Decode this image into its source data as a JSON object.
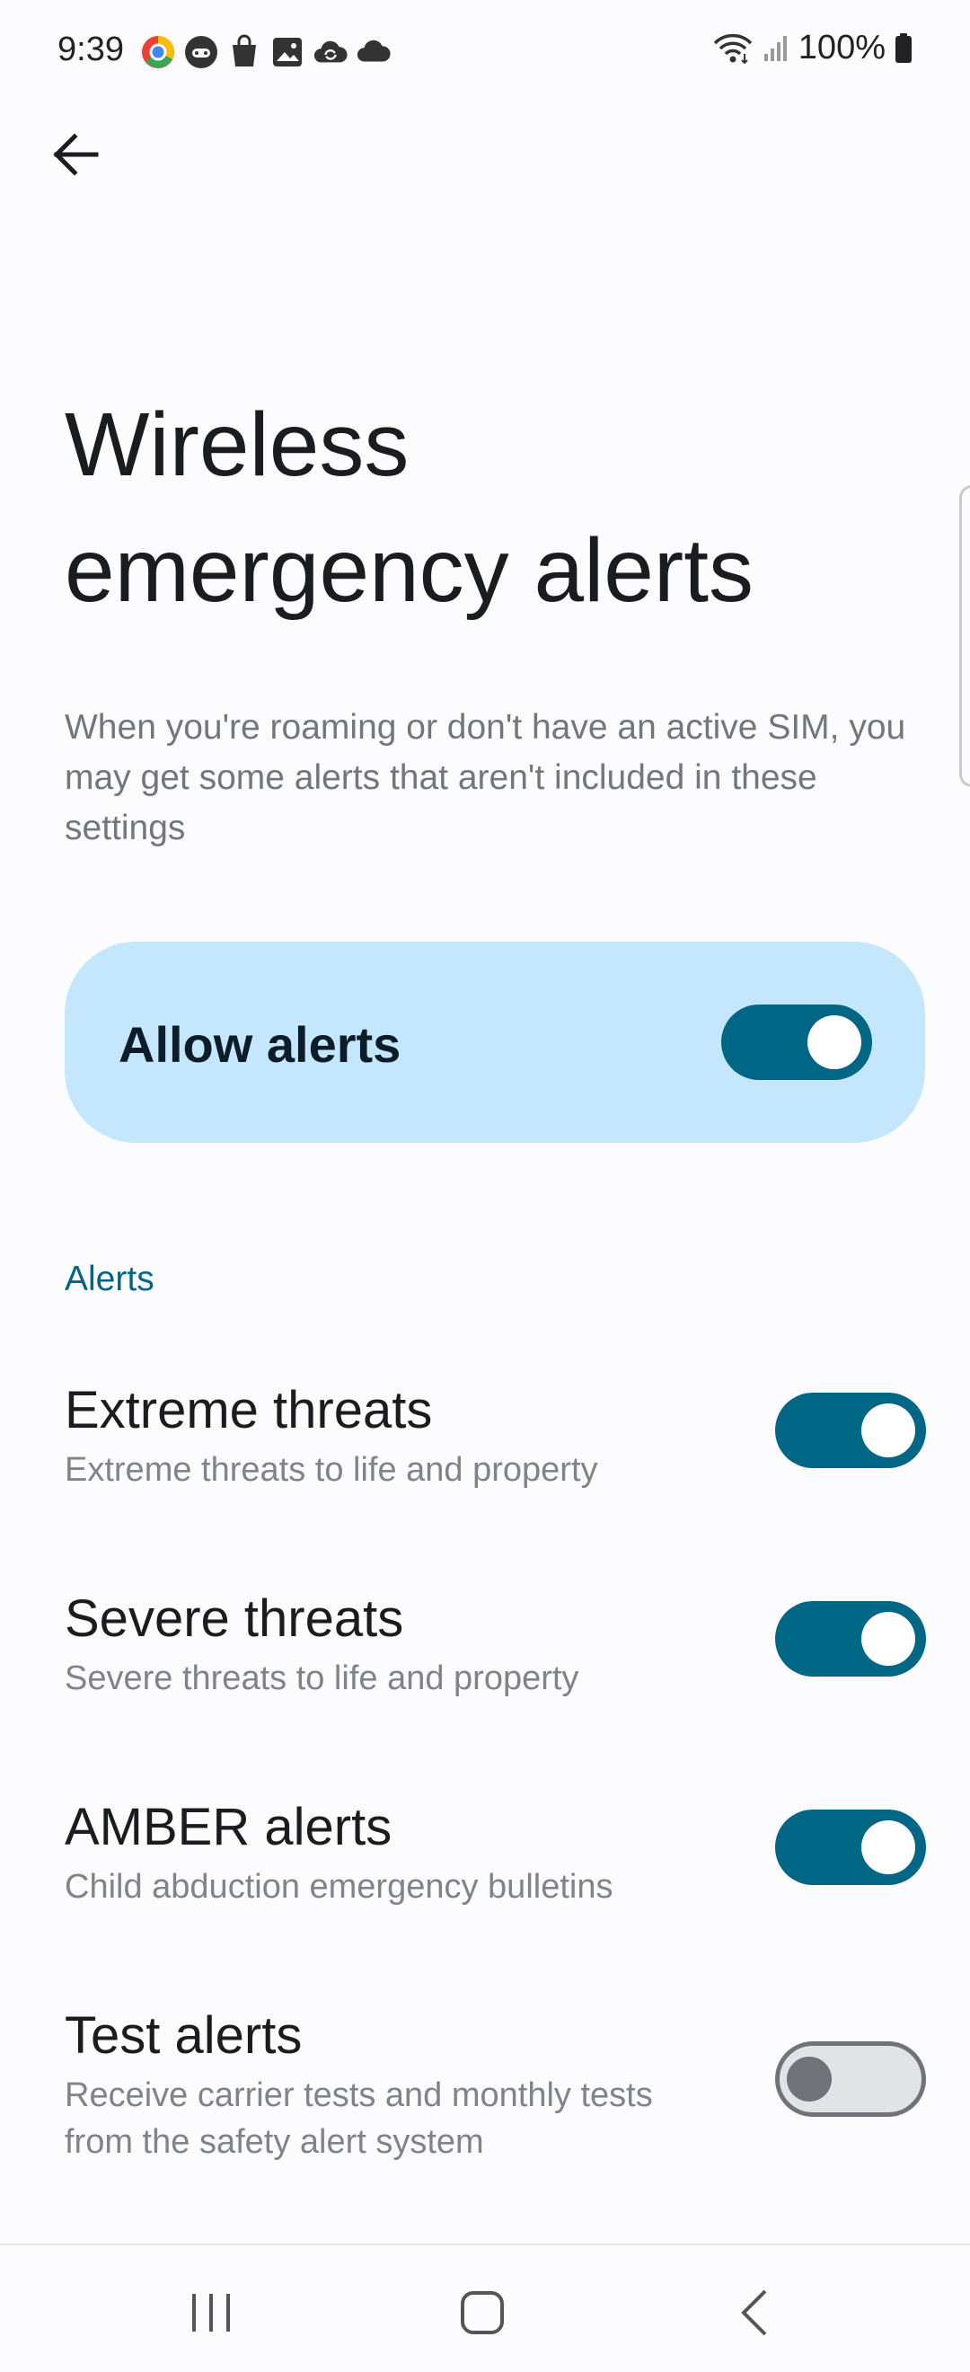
{
  "status_bar": {
    "time": "9:39",
    "battery_percent": "100%",
    "notification_icons": [
      "chrome-like-app-icon",
      "game-controller-icon",
      "shopping-bag-icon",
      "gallery-icon",
      "cloud-sync-icon",
      "cloud-icon"
    ],
    "right_icons": [
      "wifi-icon",
      "signal-icon",
      "battery-icon"
    ]
  },
  "header": {
    "back_icon": "arrow-left-icon"
  },
  "page": {
    "title_line1": "Wireless",
    "title_line2": "emergency alerts",
    "description": "When you're roaming or don't have an active SIM, you may get some alerts that aren't included in these settings"
  },
  "allow_alerts": {
    "label": "Allow alerts",
    "enabled": true
  },
  "section": {
    "header": "Alerts"
  },
  "alerts": [
    {
      "title": "Extreme threats",
      "subtitle": "Extreme threats to life and property",
      "enabled": true
    },
    {
      "title": "Severe threats",
      "subtitle": "Severe threats to life and property",
      "enabled": true
    },
    {
      "title": "AMBER alerts",
      "subtitle": "Child abduction emergency bulletins",
      "enabled": true
    },
    {
      "title": "Test alerts",
      "subtitle": "Receive carrier tests and monthly tests from the safety alert system",
      "enabled": false
    }
  ],
  "nav_bar": {
    "buttons": [
      "recents-icon",
      "home-icon",
      "back-icon"
    ]
  },
  "colors": {
    "accent": "#006686",
    "card": "#c4e7fd",
    "background": "#fcfcfe"
  }
}
